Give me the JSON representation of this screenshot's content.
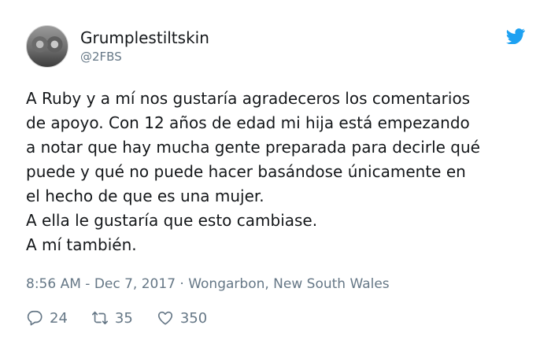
{
  "author": {
    "name": "Grumplestiltskin",
    "handle": "@2FBS"
  },
  "tweet": {
    "lines": [
      "A Ruby y a mí nos gustaría agradeceros los comentarios",
      "de apoyo. Con 12 años de edad mi hija está empezando",
      "a notar que hay mucha gente preparada para decirle qué",
      "puede y qué no puede hacer basándose únicamente en",
      "el hecho de que es una mujer.",
      "A ella le gustaría que esto cambiase.",
      "A mí también."
    ],
    "timestamp_location": "8:56 AM - Dec 7, 2017 · Wongarbon, New South Wales"
  },
  "stats": {
    "replies": "24",
    "retweets": "35",
    "likes": "350"
  },
  "icons": {
    "brand": "twitter-bird-icon",
    "reply": "reply-icon",
    "retweet": "retweet-icon",
    "like": "heart-icon"
  },
  "colors": {
    "brand": "#1da1f2",
    "text": "#14171a",
    "secondary": "#657786"
  }
}
